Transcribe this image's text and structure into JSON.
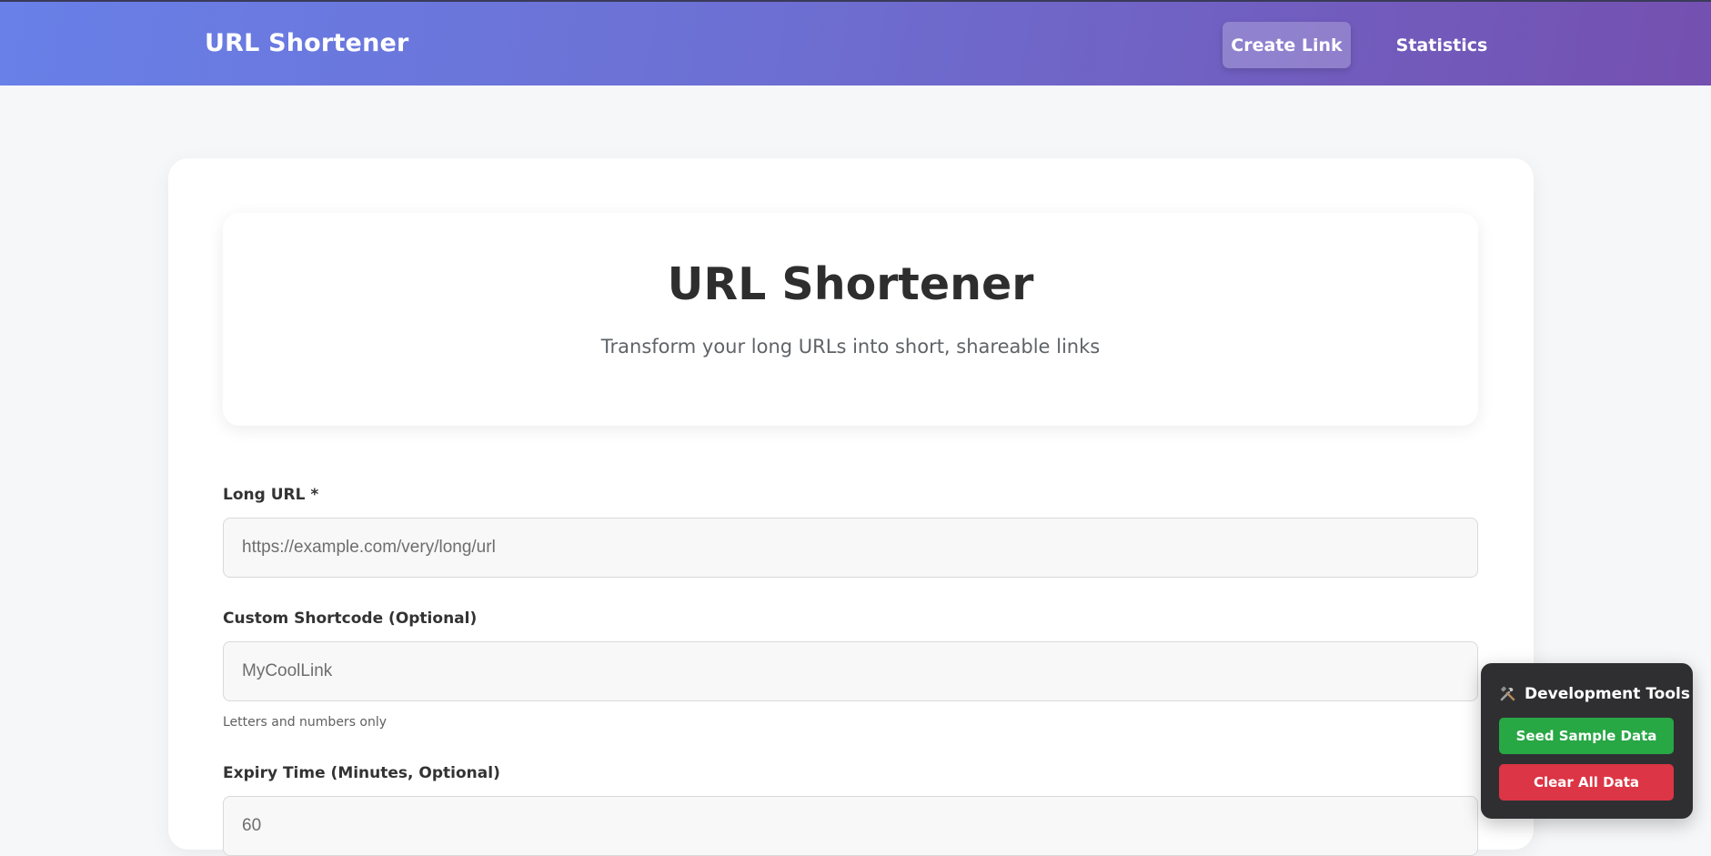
{
  "header": {
    "brand": "URL Shortener",
    "nav": {
      "create_link": "Create Link",
      "statistics": "Statistics"
    }
  },
  "hero": {
    "title": "URL Shortener",
    "subtitle": "Transform your long URLs into short, shareable links"
  },
  "form": {
    "long_url": {
      "label": "Long URL *",
      "placeholder": "https://example.com/very/long/url",
      "value": ""
    },
    "shortcode": {
      "label": "Custom Shortcode (Optional)",
      "placeholder": "MyCoolLink",
      "value": "",
      "hint": "Letters and numbers only"
    },
    "expiry": {
      "label": "Expiry Time (Minutes, Optional)",
      "placeholder": "60",
      "value": ""
    }
  },
  "devtools": {
    "title": "Development Tools",
    "icon": "tools-icon",
    "seed_label": "Seed Sample Data",
    "clear_label": "Clear All Data"
  },
  "colors": {
    "header_gradient_start": "#6880e8",
    "header_gradient_end": "#7450b0",
    "seed_button": "#28a745",
    "clear_button": "#dc3545",
    "devtools_bg": "#2f2f31"
  }
}
